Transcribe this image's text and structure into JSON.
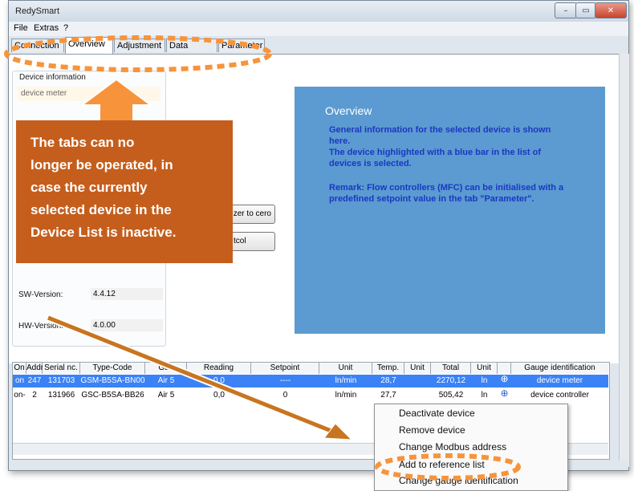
{
  "window": {
    "title": "RedySmart"
  },
  "menu": [
    "File",
    "Extras",
    "?"
  ],
  "tabs": [
    "Connection",
    "Overview",
    "Adjustment",
    "Data logging",
    "Parameter"
  ],
  "device_info": {
    "title": "Device information",
    "device_type": "device meter",
    "buttons": [
      "zer to cero",
      "tcol"
    ],
    "sw_label": "SW-Version:",
    "sw_value": "4.4.12",
    "hw_label": "HW-Version:",
    "hw_value": "4.0.00"
  },
  "overview": {
    "title": "Overview",
    "lines": [
      "General information for the selected device is shown",
      "here.",
      "The device highlighted with a blue bar in the list of",
      "devices is selected.",
      "",
      "Remark: Flow controllers (MFC) can be initialised with a",
      "predefined setpoint value in the tab \"Parameter\"."
    ]
  },
  "callout": {
    "lines": [
      "The tabs can no",
      "longer be operated, in",
      "case the currently",
      "selected device in the",
      "Device List is inactive."
    ]
  },
  "table": {
    "headers": [
      "On",
      "Addr.",
      "Serial nc.",
      "Type-Code",
      "Gas",
      "Reading",
      "Setpoint",
      "Unit",
      "Temp.",
      "Unit",
      "Total",
      "Unit",
      "",
      "Gauge identification"
    ],
    "rows": [
      [
        "on",
        "247",
        "131703",
        "GSM-B5SA-BN00",
        "Air 5",
        "0,0",
        "----",
        "ln/min",
        "28,7",
        "",
        "2270,12",
        "ln",
        "",
        "device meter"
      ],
      [
        "on-",
        "2",
        "131966",
        "GSC-B5SA-BB26",
        "Air 5",
        "0,0",
        "0",
        "ln/min",
        "27,7",
        "",
        "505,42",
        "ln",
        "",
        "device controller"
      ]
    ]
  },
  "context_menu": [
    "Deactivate device",
    "Remove device",
    "Change Modbus address",
    "Add to reference list",
    "Change gauge identification"
  ],
  "colors": {
    "accent": "#5b9bd1",
    "callout": "#c55e1c",
    "highlight": "#f7943b",
    "row_selected": "#3b82f6"
  }
}
